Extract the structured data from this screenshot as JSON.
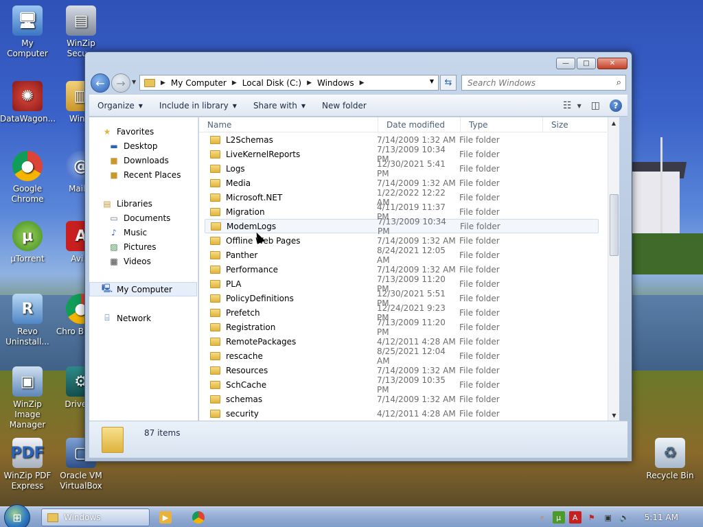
{
  "desktop": {
    "icons": [
      {
        "label": "My Computer"
      },
      {
        "label": "WinZip Secu..."
      },
      {
        "label": "DataWagon..."
      },
      {
        "label": "Win..."
      },
      {
        "label": "Google Chrome"
      },
      {
        "label": "Mail..."
      },
      {
        "label": "µTorrent"
      },
      {
        "label": "Avi..."
      },
      {
        "label": "Revo Uninstall..."
      },
      {
        "label": "Chro Brow..."
      },
      {
        "label": "WinZip Image Manager"
      },
      {
        "label": "Driver..."
      },
      {
        "label": "WinZip PDF Express"
      },
      {
        "label": "Oracle VM VirtualBox"
      },
      {
        "label": "Recycle Bin"
      }
    ]
  },
  "window": {
    "title_buttons": {
      "minimize": "—",
      "maximize": "□",
      "close": "✕"
    },
    "breadcrumbs": [
      "My Computer",
      "Local Disk (C:)",
      "Windows"
    ],
    "search_placeholder": "Search Windows",
    "toolbar": {
      "organize": "Organize",
      "include_in_library": "Include in library",
      "share_with": "Share with",
      "new_folder": "New folder"
    },
    "nav": {
      "favorites": {
        "label": "Favorites",
        "items": [
          "Desktop",
          "Downloads",
          "Recent Places"
        ]
      },
      "libraries": {
        "label": "Libraries",
        "items": [
          "Documents",
          "Music",
          "Pictures",
          "Videos"
        ]
      },
      "computer": "My Computer",
      "network": "Network"
    },
    "columns": {
      "name": "Name",
      "date": "Date modified",
      "type": "Type",
      "size": "Size"
    },
    "files": [
      {
        "name": "L2Schemas",
        "date": "7/14/2009 1:32 AM",
        "type": "File folder"
      },
      {
        "name": "LiveKernelReports",
        "date": "7/13/2009 10:34 PM",
        "type": "File folder"
      },
      {
        "name": "Logs",
        "date": "12/30/2021 5:41 PM",
        "type": "File folder"
      },
      {
        "name": "Media",
        "date": "7/14/2009 1:32 AM",
        "type": "File folder"
      },
      {
        "name": "Microsoft.NET",
        "date": "1/22/2022 12:22 AM",
        "type": "File folder"
      },
      {
        "name": "Migration",
        "date": "4/11/2019 11:37 PM",
        "type": "File folder"
      },
      {
        "name": "ModemLogs",
        "date": "7/13/2009 10:34 PM",
        "type": "File folder"
      },
      {
        "name": "Offline Web Pages",
        "date": "7/14/2009 1:32 AM",
        "type": "File folder"
      },
      {
        "name": "Panther",
        "date": "8/24/2021 12:05 AM",
        "type": "File folder"
      },
      {
        "name": "Performance",
        "date": "7/14/2009 1:32 AM",
        "type": "File folder"
      },
      {
        "name": "PLA",
        "date": "7/13/2009 11:20 PM",
        "type": "File folder"
      },
      {
        "name": "PolicyDefinitions",
        "date": "12/30/2021 5:51 PM",
        "type": "File folder"
      },
      {
        "name": "Prefetch",
        "date": "12/24/2021 9:23 PM",
        "type": "File folder"
      },
      {
        "name": "Registration",
        "date": "7/13/2009 11:20 PM",
        "type": "File folder"
      },
      {
        "name": "RemotePackages",
        "date": "4/12/2011 4:28 AM",
        "type": "File folder"
      },
      {
        "name": "rescache",
        "date": "8/25/2021 12:04 AM",
        "type": "File folder"
      },
      {
        "name": "Resources",
        "date": "7/14/2009 1:32 AM",
        "type": "File folder"
      },
      {
        "name": "SchCache",
        "date": "7/13/2009 10:35 PM",
        "type": "File folder"
      },
      {
        "name": "schemas",
        "date": "7/14/2009 1:32 AM",
        "type": "File folder"
      },
      {
        "name": "security",
        "date": "4/12/2011 4:28 AM",
        "type": "File folder"
      }
    ],
    "status": "87 items"
  },
  "taskbar": {
    "active_window": "Windows",
    "clock": "5:11 AM"
  }
}
